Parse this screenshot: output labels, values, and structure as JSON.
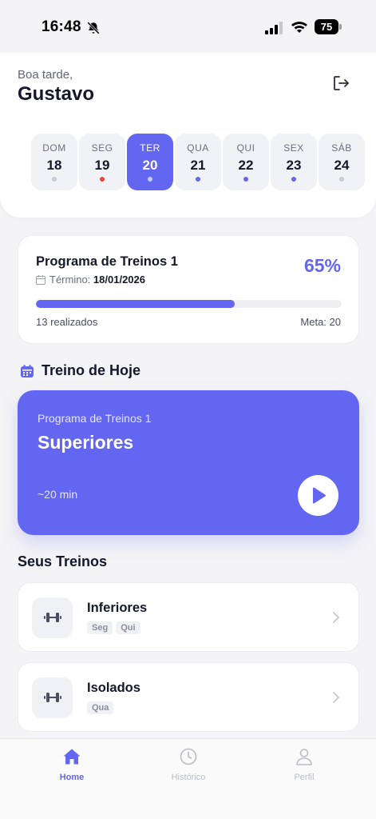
{
  "status_bar": {
    "time": "16:48",
    "battery": "75"
  },
  "header": {
    "greeting": "Boa tarde,",
    "user_name": "Gustavo",
    "days": [
      {
        "label": "DOM",
        "date": "18",
        "dot_color": "#c9cbd3",
        "active": false
      },
      {
        "label": "SEG",
        "date": "19",
        "dot_color": "#ef4444",
        "active": false
      },
      {
        "label": "TER",
        "date": "20",
        "dot_color": "#c7c9ff",
        "active": true
      },
      {
        "label": "QUA",
        "date": "21",
        "dot_color": "#6366f1",
        "active": false
      },
      {
        "label": "QUI",
        "date": "22",
        "dot_color": "#6366f1",
        "active": false
      },
      {
        "label": "SEX",
        "date": "23",
        "dot_color": "#6366f1",
        "active": false
      },
      {
        "label": "SÁB",
        "date": "24",
        "dot_color": "#c9cbd3",
        "active": false
      }
    ]
  },
  "program": {
    "title": "Programa de Treinos 1",
    "percent_label": "65%",
    "progress": 0.65,
    "end_label": "Término:",
    "end_date": "18/01/2026",
    "done_label": "13 realizados",
    "goal_label": "Meta: 20"
  },
  "today": {
    "section_title": "Treino de Hoje",
    "program_name": "Programa de Treinos 1",
    "workout_name": "Superiores",
    "duration": "~20 min"
  },
  "workouts": {
    "section_title": "Seus Treinos",
    "items": [
      {
        "name": "Inferiores",
        "tags": [
          "Seg",
          "Qui"
        ]
      },
      {
        "name": "Isolados",
        "tags": [
          "Qua"
        ]
      }
    ]
  },
  "tabs": [
    {
      "label": "Home",
      "icon": "home-icon",
      "active": true
    },
    {
      "label": "Histórico",
      "icon": "clock-icon",
      "active": false
    },
    {
      "label": "Perfil",
      "icon": "user-icon",
      "active": false
    }
  ],
  "colors": {
    "accent": "#6366f1",
    "text": "#15172b",
    "muted": "#6a6e80"
  }
}
